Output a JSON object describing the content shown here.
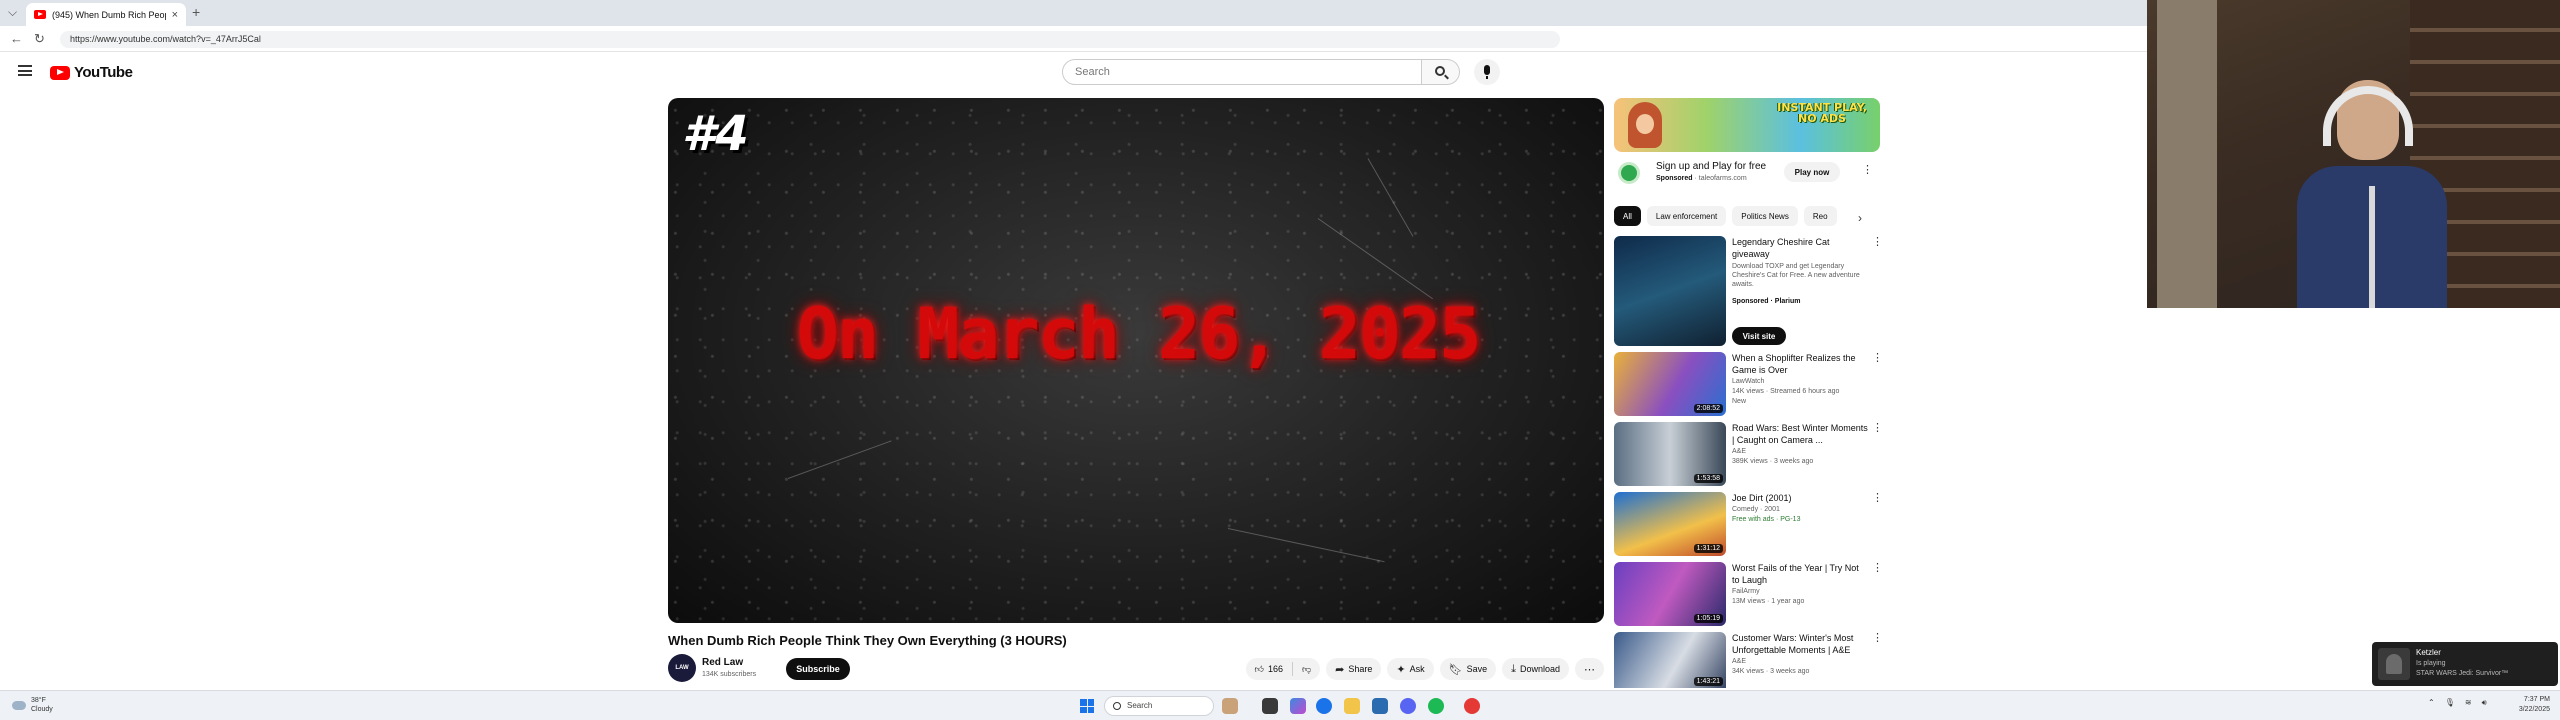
{
  "browser": {
    "tab_title": "(945) When Dumb Rich People",
    "url": "https://www.youtube.com/watch?v=_47ArrJ5Cal",
    "new_tab": "+"
  },
  "header": {
    "logo_text": "YouTube",
    "search_placeholder": "Search"
  },
  "player": {
    "badge": "#4",
    "headline": "On March 26, 2025"
  },
  "video": {
    "title": "When Dumb Rich People Think They Own Everything (3 HOURS)",
    "channel": "Red Law",
    "subscribers": "134K subscribers",
    "subscribe_label": "Subscribe",
    "like_count": "166",
    "share_label": "Share",
    "ask_label": "Ask",
    "save_label": "Save",
    "download_label": "Download"
  },
  "ad": {
    "banner_line1": "INSTANT PLAY,",
    "banner_line2": "NO ADS",
    "title": "Sign up and Play for free",
    "sponsored": "Sponsored",
    "domain": "taleofarms.com",
    "cta": "Play now"
  },
  "chips": [
    "All",
    "Law enforcement",
    "Politics News",
    "Reo"
  ],
  "recommendations": [
    {
      "title": "Legendary Cheshire Cat giveaway",
      "line1": "Download TOXP and get Legendary Cheshire's Cat for Free. A new adventure awaits.",
      "line2": "Sponsored · Plarium",
      "cta": "Visit site",
      "duration": ""
    },
    {
      "title": "When a Shoplifter Realizes the Game is Over",
      "line1": "LawWatch",
      "line2": "14K views · Streamed 6 hours ago",
      "line3": "New",
      "duration": "2:08:52"
    },
    {
      "title": "Road Wars: Best Winter Moments | Caught on Camera ...",
      "line1": "A&E",
      "line2": "389K views · 3 weeks ago",
      "duration": "1:53:58"
    },
    {
      "title": "Joe Dirt (2001)",
      "line1": "Comedy · 2001",
      "line2": "Free with ads · PG-13",
      "duration": "1:31:12"
    },
    {
      "title": "Worst Fails of the Year | Try Not to Laugh",
      "line1": "FailArmy",
      "line2": "13M views · 1 year ago",
      "duration": "1:05:19"
    },
    {
      "title": "Customer Wars: Winter's Most Unforgettable Moments | A&E",
      "line1": "A&E",
      "line2": "34K views · 3 weeks ago",
      "duration": "1:43:21"
    }
  ],
  "taskbar": {
    "temperature": "38°F",
    "condition": "Cloudy",
    "search_label": "Search",
    "time": "7:37 PM",
    "date": "3/22/2025"
  },
  "now_playing": {
    "app": "Ketzler",
    "status": "Is playing",
    "track": "STAR WARS Jedi: Survivor™"
  },
  "colors": {
    "accent": "#ff0000",
    "headline_red": "#d40a0a"
  }
}
